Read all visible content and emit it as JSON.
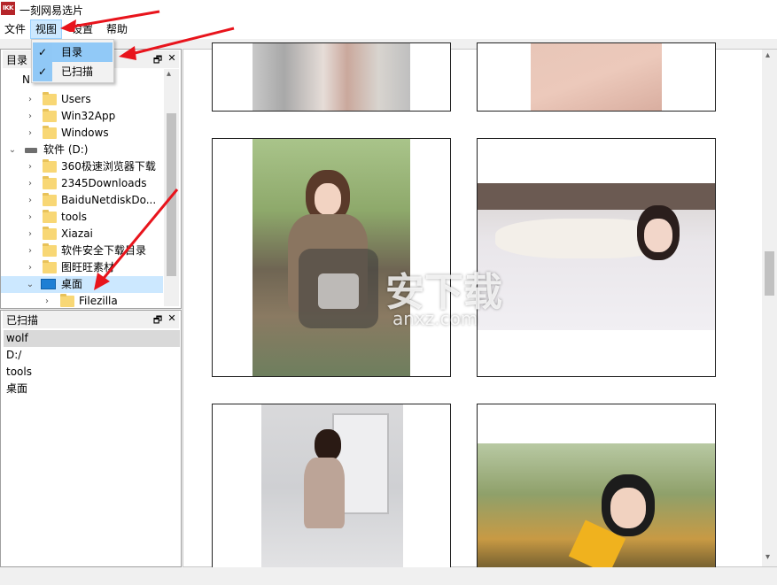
{
  "app": {
    "icon_label": "IKK",
    "title": "一刻网易选片"
  },
  "menubar": {
    "items": [
      "文件",
      "视图",
      "设置",
      "帮助"
    ]
  },
  "view_menu": {
    "items": [
      {
        "label": "目录",
        "checked": true
      },
      {
        "label": "已扫描",
        "checked": true
      }
    ]
  },
  "directory_panel": {
    "title": "目录",
    "partial_row": "N",
    "items": [
      "Users",
      "Win32App",
      "Windows",
      "软件 (D:)",
      "360极速浏览器下载",
      "2345Downloads",
      "BaiduNetdiskDo...",
      "tools",
      "Xiazai",
      "软件安全下载目录",
      "图旺旺素材",
      "桌面",
      "Filezilla"
    ]
  },
  "scanned_panel": {
    "title": "已扫描",
    "items": [
      "wolf",
      "D:/",
      "tools",
      "桌面"
    ]
  },
  "panel_buttons": {
    "float": "🗗",
    "close": "✕"
  },
  "scrollbar": {
    "up": "▴",
    "down": "▾"
  },
  "watermark": {
    "text": "安下载",
    "url": "anxz.com"
  },
  "colors": {
    "accent": "#cce8ff",
    "menu_check": "#90c8f6",
    "arrow": "#e8141c",
    "app_icon": "#b5252a"
  }
}
